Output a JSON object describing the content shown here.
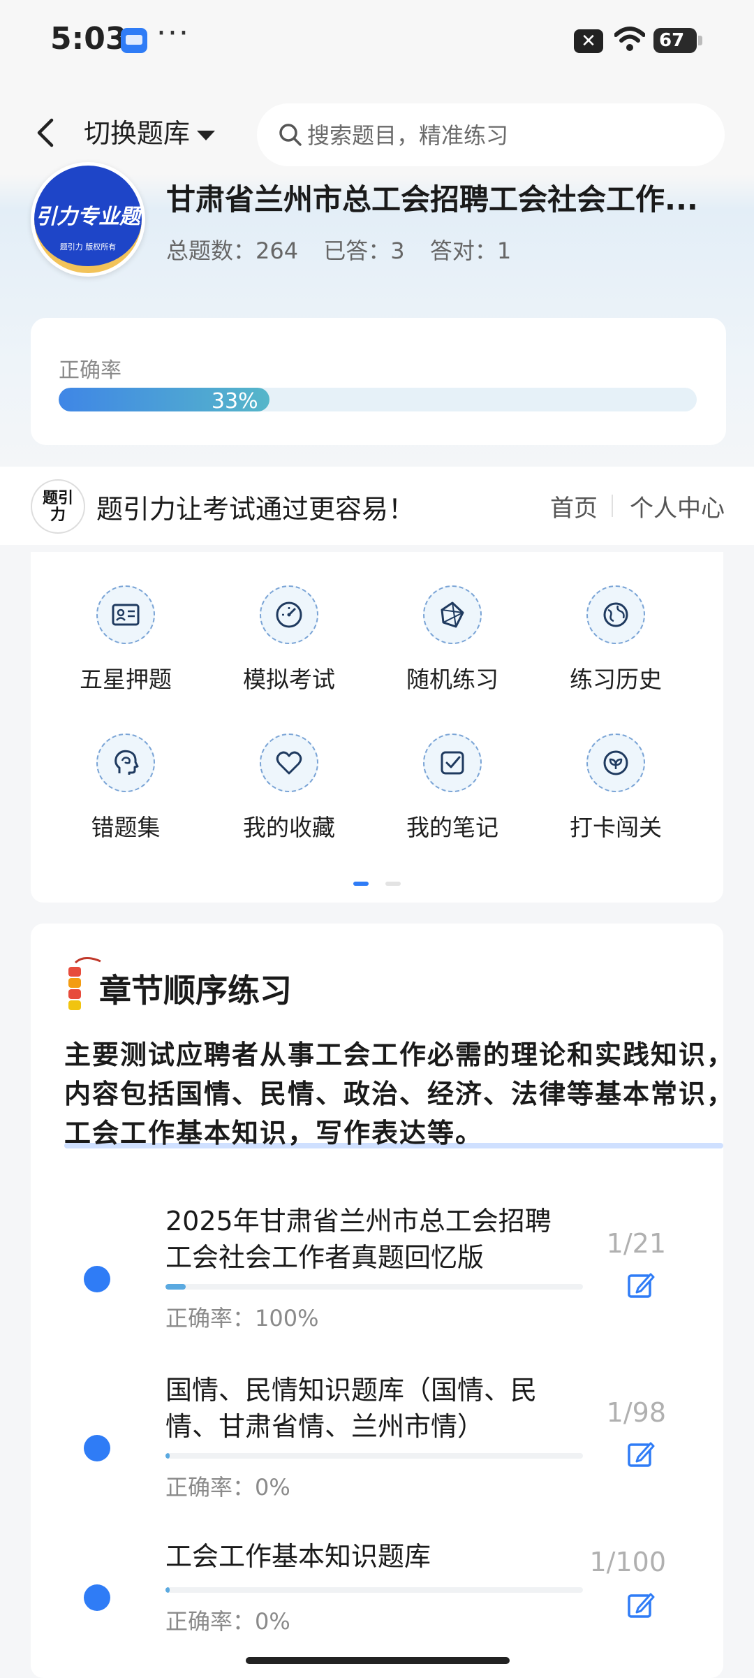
{
  "status_bar": {
    "time": "5:03",
    "battery": "67"
  },
  "nav": {
    "switch_label": "切换题库",
    "search_placeholder": "搜索题目，精准练习"
  },
  "bank": {
    "logo_text": "引力专业题",
    "logo_sub": "题引力 版权所有",
    "title": "甘肃省兰州市总工会招聘工会社会工作...",
    "stats": {
      "total": "总题数：264",
      "answered": "已答：3",
      "correct": "答对：1"
    }
  },
  "accuracy": {
    "label": "正确率",
    "value_text": "33%",
    "fraction": 0.33
  },
  "promo": {
    "logo_text": "题引力",
    "slogan": "题引力让考试通过更容易！",
    "home": "首页",
    "personal": "个人中心"
  },
  "menu": [
    {
      "label": "五星押题",
      "icon": "id-card-icon"
    },
    {
      "label": "模拟考试",
      "icon": "speedometer-icon"
    },
    {
      "label": "随机练习",
      "icon": "random-shape-icon"
    },
    {
      "label": "练习历史",
      "icon": "globe-icon"
    },
    {
      "label": "错题集",
      "icon": "head-brain-icon"
    },
    {
      "label": "我的收藏",
      "icon": "heart-icon"
    },
    {
      "label": "我的笔记",
      "icon": "note-check-icon"
    },
    {
      "label": "打卡闯关",
      "icon": "leaf-badge-icon"
    }
  ],
  "chapter": {
    "title": "章节顺序练习",
    "description": "主要测试应聘者从事工会工作必需的理论和实践知识，内容包括国情、民情、政治、经济、法律等基本常识，工会工作基本知识，写作表达等。",
    "items": [
      {
        "title": "2025年甘肃省兰州市总工会招聘工会社会工作者真题回忆版",
        "accuracy": "正确率：100%",
        "count": "1/21",
        "progress": 0.048
      },
      {
        "title": "国情、民情知识题库（国情、民情、甘肃省情、兰州市情）",
        "accuracy": "正确率：0%",
        "count": "1/98",
        "progress": 0.01
      },
      {
        "title": "工会工作基本知识题库",
        "accuracy": "正确率：0%",
        "count": "1/100",
        "progress": 0.01
      }
    ]
  },
  "colors": {
    "accent": "#2f7cf6",
    "progress": "#5aa9e0",
    "logo_blue": "#1e45c8"
  }
}
